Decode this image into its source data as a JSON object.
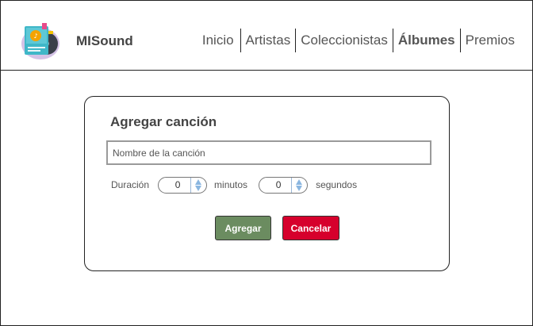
{
  "header": {
    "brand": "MISound",
    "nav": [
      {
        "label": "Inicio",
        "active": false
      },
      {
        "label": "Artistas",
        "active": false
      },
      {
        "label": "Coleccionistas",
        "active": false
      },
      {
        "label": "Álbumes",
        "active": true
      },
      {
        "label": "Premios",
        "active": false
      }
    ]
  },
  "form": {
    "title": "Agregar canción",
    "song_name_placeholder": "Nombre de la canción",
    "song_name_value": "",
    "duration_label": "Duración",
    "minutes_value": "0",
    "minutes_label": "minutos",
    "seconds_value": "0",
    "seconds_label": "segundos",
    "add_label": "Agregar",
    "cancel_label": "Cancelar"
  },
  "colors": {
    "add_button": "#6b8c60",
    "cancel_button": "#d6002c",
    "spinner_accent": "#8ab6e0"
  }
}
